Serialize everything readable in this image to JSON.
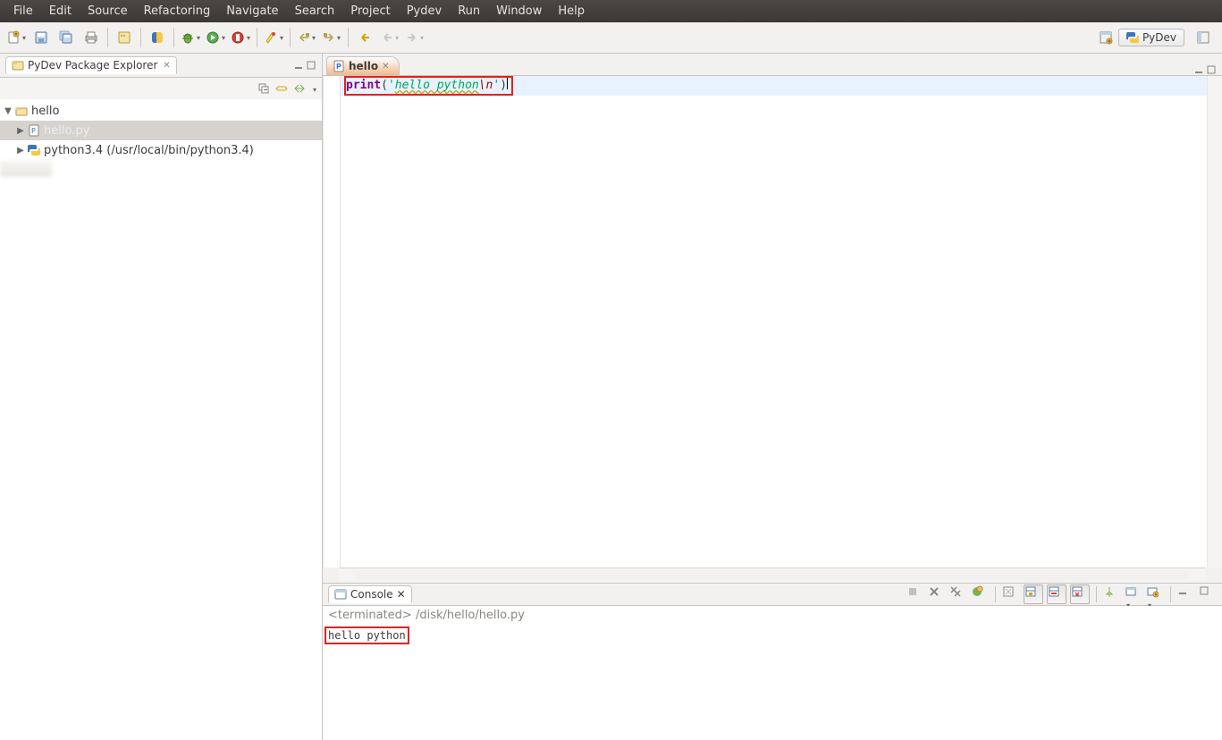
{
  "menubar": [
    "File",
    "Edit",
    "Source",
    "Refactoring",
    "Navigate",
    "Search",
    "Project",
    "Pydev",
    "Run",
    "Window",
    "Help"
  ],
  "perspective": {
    "name": "PyDev"
  },
  "explorer": {
    "title": "PyDev Package Explorer",
    "project": "hello",
    "file": "hello.py",
    "interpreter": "python3.4 (/usr/local/bin/python3.4)"
  },
  "editor": {
    "tab_title": "hello",
    "code": {
      "kw": "print",
      "paren_open": "(",
      "str_open": "'",
      "str_body": "hello python",
      "str_esc": "\\n",
      "str_close": "'",
      "paren_close": ")"
    }
  },
  "console": {
    "title": "Console",
    "status_prefix": "<terminated>",
    "status_path": "/disk/hello/hello.py",
    "output": "hello python"
  }
}
